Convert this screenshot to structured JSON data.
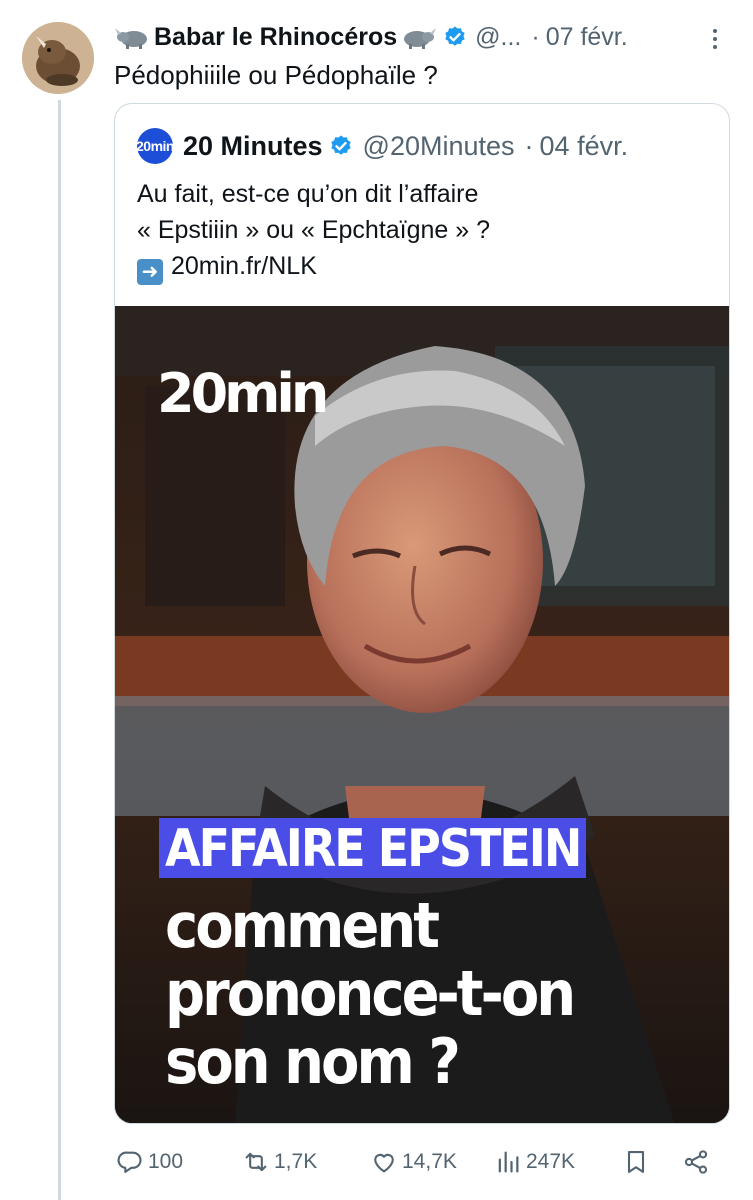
{
  "tweet": {
    "display_name": "Babar le Rhinocéros",
    "handle": "@...",
    "date": "07 févr.",
    "text": "Pédophiiile ou Pédophaïle ?"
  },
  "quoted": {
    "display_name": "20 Minutes",
    "avatar_text": "20min",
    "handle": "@20Minutes",
    "date": "04 févr.",
    "text_line1": "Au fait, est-ce qu’on dit l’affaire",
    "text_line2": "« Epstiiin » ou « Epchtaïgne » ?",
    "link": "20min.fr/NLK",
    "media": {
      "logo": "20min",
      "headline": "AFFAIRE EPSTEIN",
      "line1": "comment",
      "line2": "prononce-t-on",
      "line3": "son nom ?"
    }
  },
  "actions": {
    "replies": "100",
    "reposts": "1,7K",
    "likes": "14,7K",
    "views": "247K"
  },
  "colors": {
    "verified": "#1d9bf0",
    "secondary_text": "#536471",
    "headline_bg": "#4a4ee6"
  },
  "icons": [
    "rhino-emoji-icon",
    "verified-badge-icon",
    "more-icon",
    "reply-icon",
    "repost-icon",
    "like-icon",
    "views-icon",
    "bookmark-icon",
    "share-icon"
  ]
}
